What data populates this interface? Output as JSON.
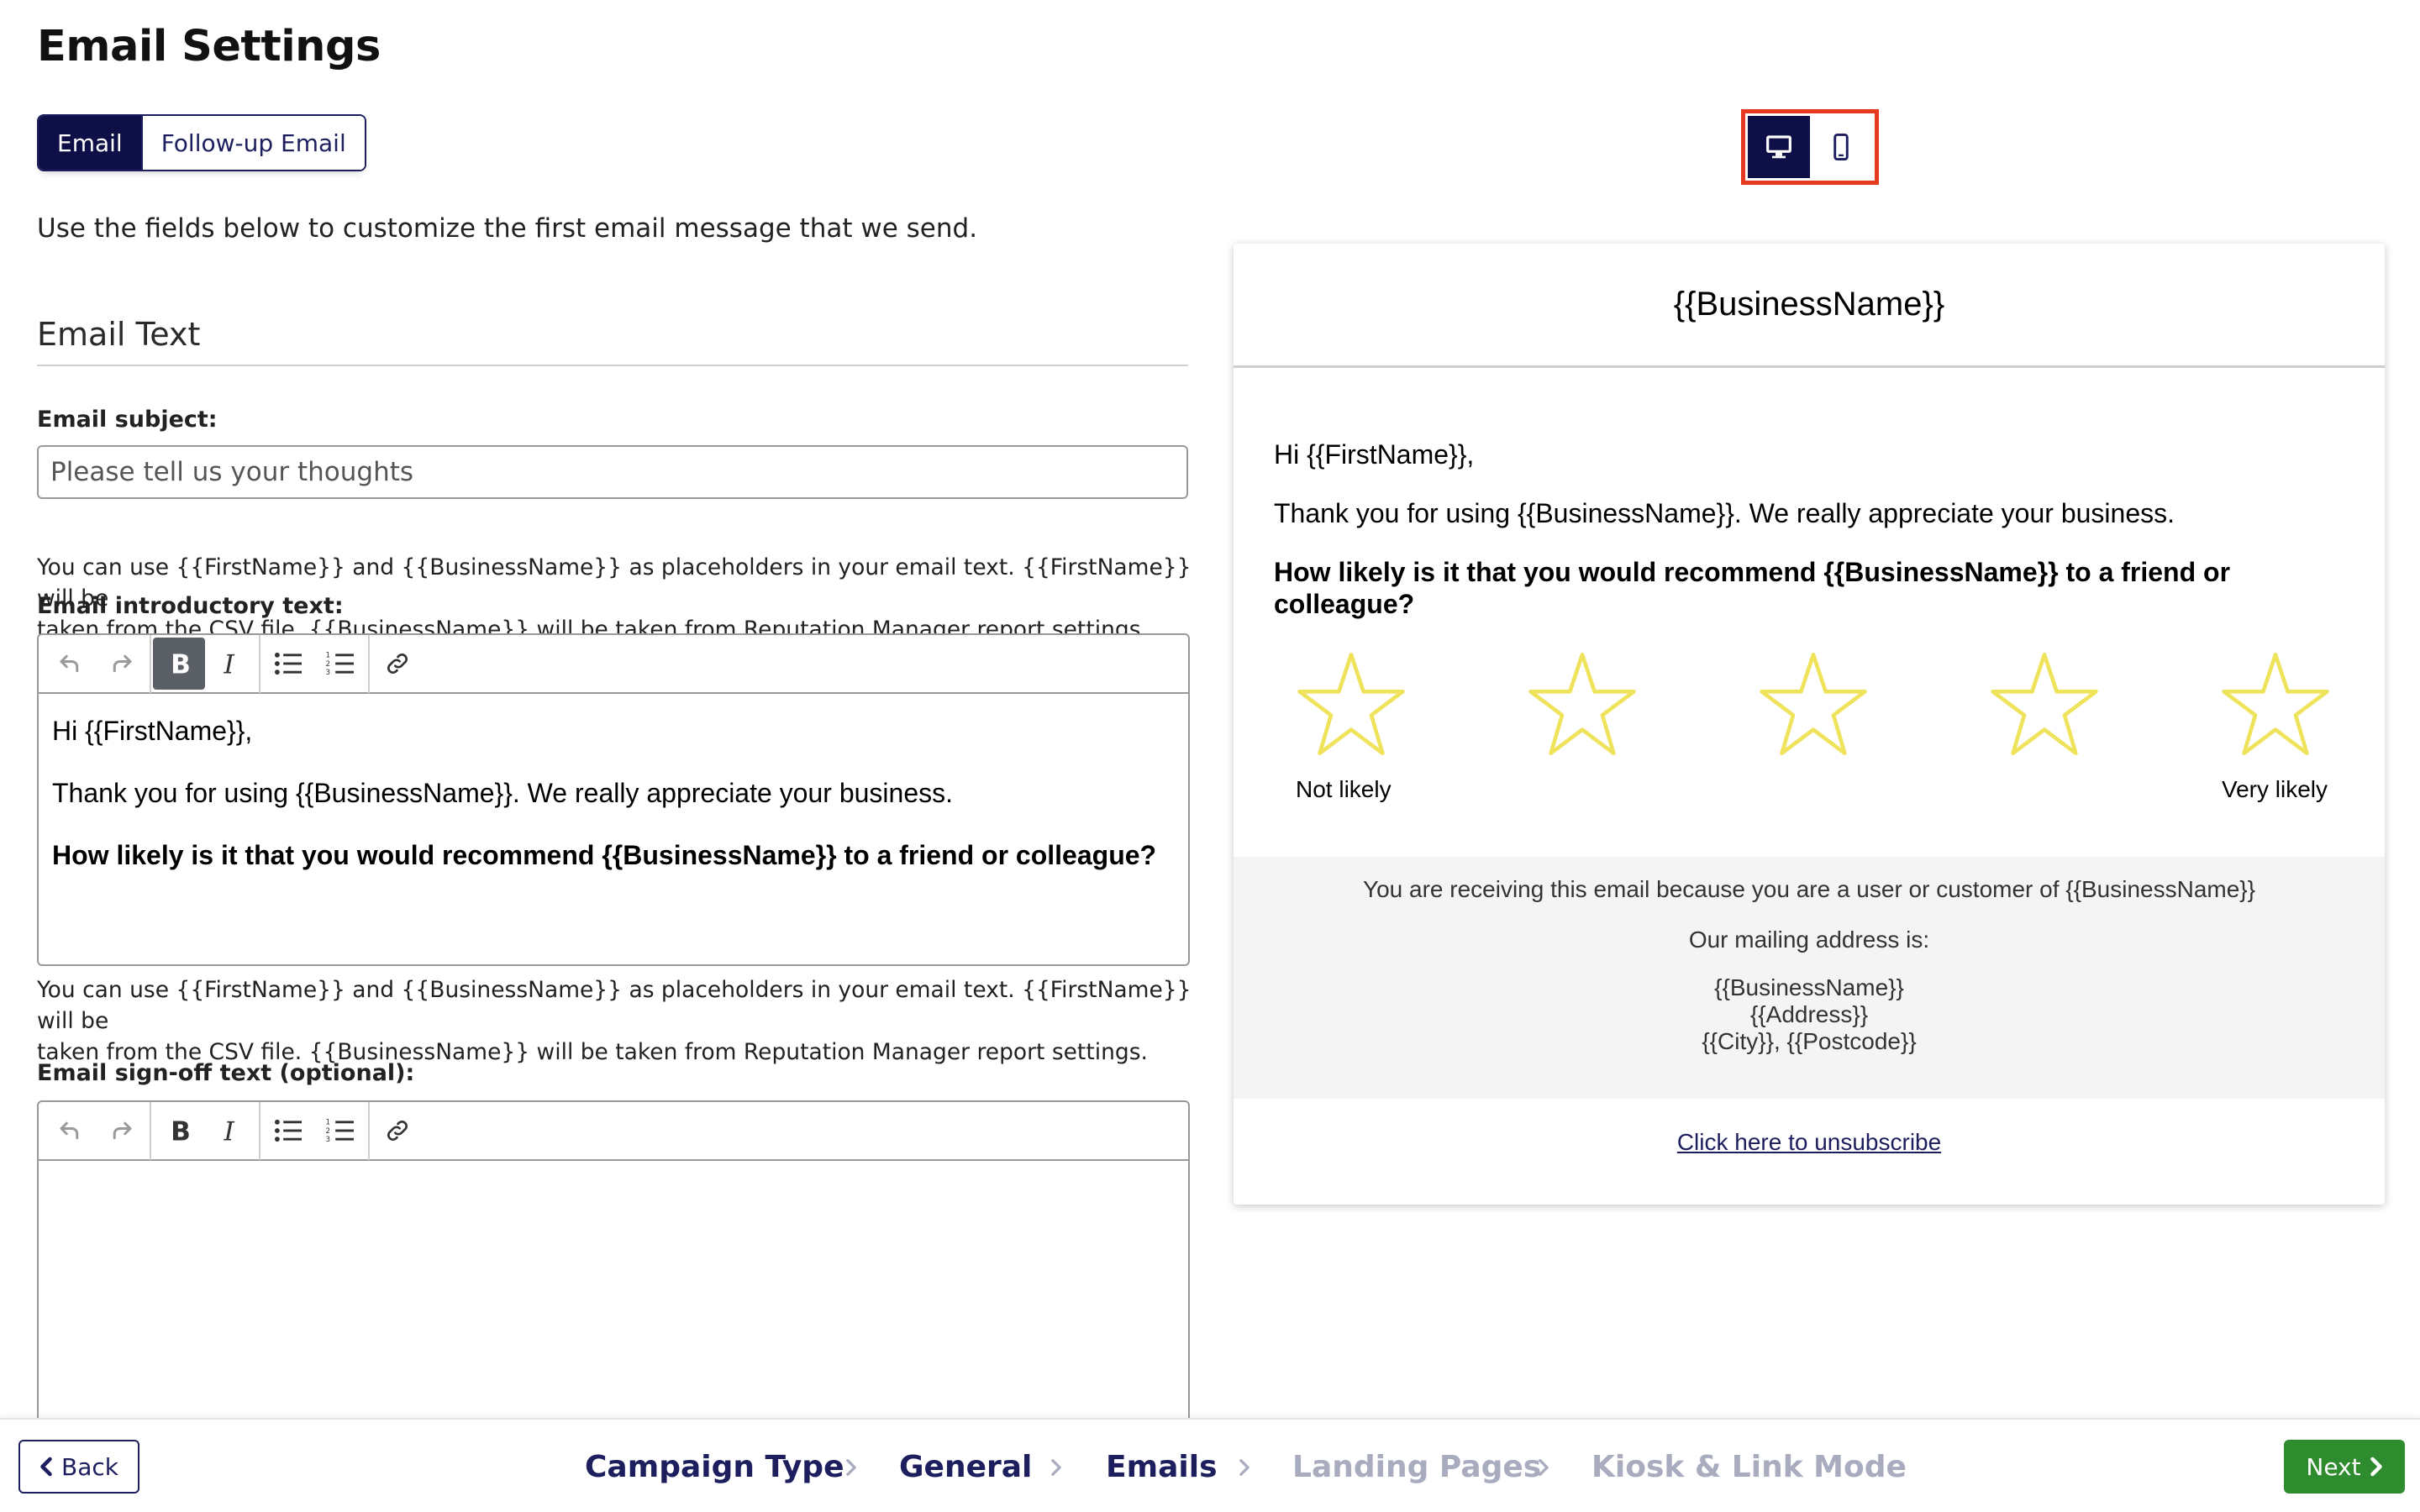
{
  "page": {
    "title": "Email Settings"
  },
  "tabs": [
    {
      "label": "Email",
      "active": true
    },
    {
      "label": "Follow-up Email",
      "active": false
    }
  ],
  "intro": "Use the fields below to customize the first email message that we send.",
  "section": {
    "heading": "Email Text"
  },
  "subject": {
    "label": "Email subject:",
    "placeholder": "Please tell us your thoughts",
    "help_line1": "You can use {{FirstName}} and {{BusinessName}} as placeholders in your email text. {{FirstName}} will be",
    "help_line2": "taken from the CSV file. {{BusinessName}} will be taken from Reputation Manager report settings."
  },
  "intro_editor": {
    "label": "Email introductory text:",
    "lines": [
      "Hi {{FirstName}},",
      "Thank you for using {{BusinessName}}. We really appreciate your business.",
      "How likely is it that you would recommend {{BusinessName}} to a friend or colleague?"
    ],
    "help_line1": "You can use {{FirstName}} and {{BusinessName}} as placeholders in your email text. {{FirstName}} will be",
    "help_line2": "taken from the CSV file. {{BusinessName}} will be taken from Reputation Manager report settings."
  },
  "signoff_editor": {
    "label": "Email sign-off text (optional):"
  },
  "toolbar_icons": [
    "undo-icon",
    "redo-icon",
    "bold-icon",
    "italic-icon",
    "bullet-list-icon",
    "numbered-list-icon",
    "link-icon"
  ],
  "device_toggle": {
    "selected": "desktop",
    "options": [
      "desktop-icon",
      "mobile-icon"
    ]
  },
  "preview": {
    "header": "{{BusinessName}}",
    "greeting": "Hi {{FirstName}},",
    "thanks": "Thank you for using {{BusinessName}}. We really appreciate your business.",
    "question_line1": "How likely is it that you would recommend {{BusinessName}} to a friend or",
    "question_line2": "colleague?",
    "rating_max": 5,
    "label_low": "Not likely",
    "label_high": "Very likely",
    "footer_receiving": "You are receiving this email because you are a user or customer of {{BusinessName}}",
    "footer_mailing": "Our mailing address is:",
    "address": [
      "{{BusinessName}}",
      "{{Address}}",
      "{{City}}, {{Postcode}}"
    ],
    "unsubscribe": "Click here to unsubscribe"
  },
  "navigation": {
    "back": "Back",
    "next": "Next",
    "steps": [
      {
        "label": "Campaign Type",
        "state": "done"
      },
      {
        "label": "General",
        "state": "done"
      },
      {
        "label": "Emails",
        "state": "current"
      },
      {
        "label": "Landing Pages",
        "state": "future"
      },
      {
        "label": "Kiosk & Link Mode",
        "state": "future"
      }
    ]
  },
  "colors": {
    "navy": "#0e0f47",
    "accent_red": "#e63a1e",
    "star": "#efe35c",
    "next_green": "#2e8b2e",
    "step_future": "#a9abbf"
  }
}
